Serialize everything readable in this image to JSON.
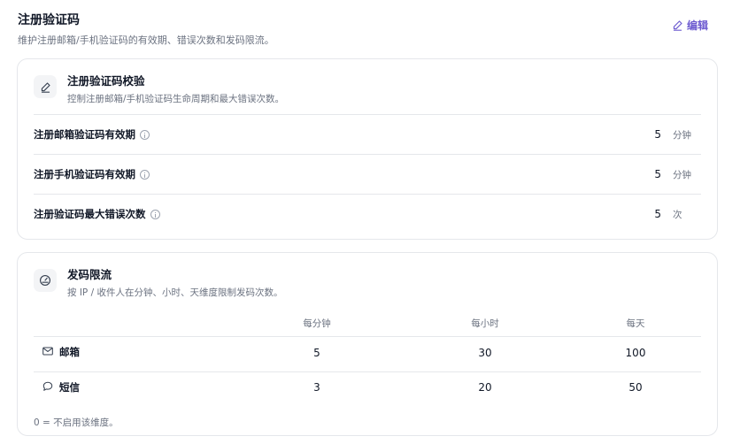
{
  "header": {
    "title": "注册验证码",
    "subtitle": "维护注册邮箱/手机验证码的有效期、错误次数和发码限流。",
    "edit_label": "编辑"
  },
  "verify_card": {
    "title": "注册验证码校验",
    "description": "控制注册邮箱/手机验证码生命周期和最大错误次数。",
    "icon": "pen-icon",
    "rows": [
      {
        "label": "注册邮箱验证码有效期",
        "value": "5",
        "unit": "分钟"
      },
      {
        "label": "注册手机验证码有效期",
        "value": "5",
        "unit": "分钟"
      },
      {
        "label": "注册验证码最大错误次数",
        "value": "5",
        "unit": "次"
      }
    ]
  },
  "rate_card": {
    "title": "发码限流",
    "description": "按 IP / 收件人在分钟、小时、天维度限制发码次数。",
    "icon": "gauge-icon",
    "columns": [
      "每分钟",
      "每小时",
      "每天"
    ],
    "rows": [
      {
        "label": "邮箱",
        "icon": "mail-icon",
        "values": [
          "5",
          "30",
          "100"
        ]
      },
      {
        "label": "短信",
        "icon": "message-icon",
        "values": [
          "3",
          "20",
          "50"
        ]
      }
    ],
    "footnote": "0 = 不启用该维度。"
  },
  "colors": {
    "accent": "#6d5bd0",
    "border": "#e5e7eb",
    "muted": "#6b7280"
  }
}
